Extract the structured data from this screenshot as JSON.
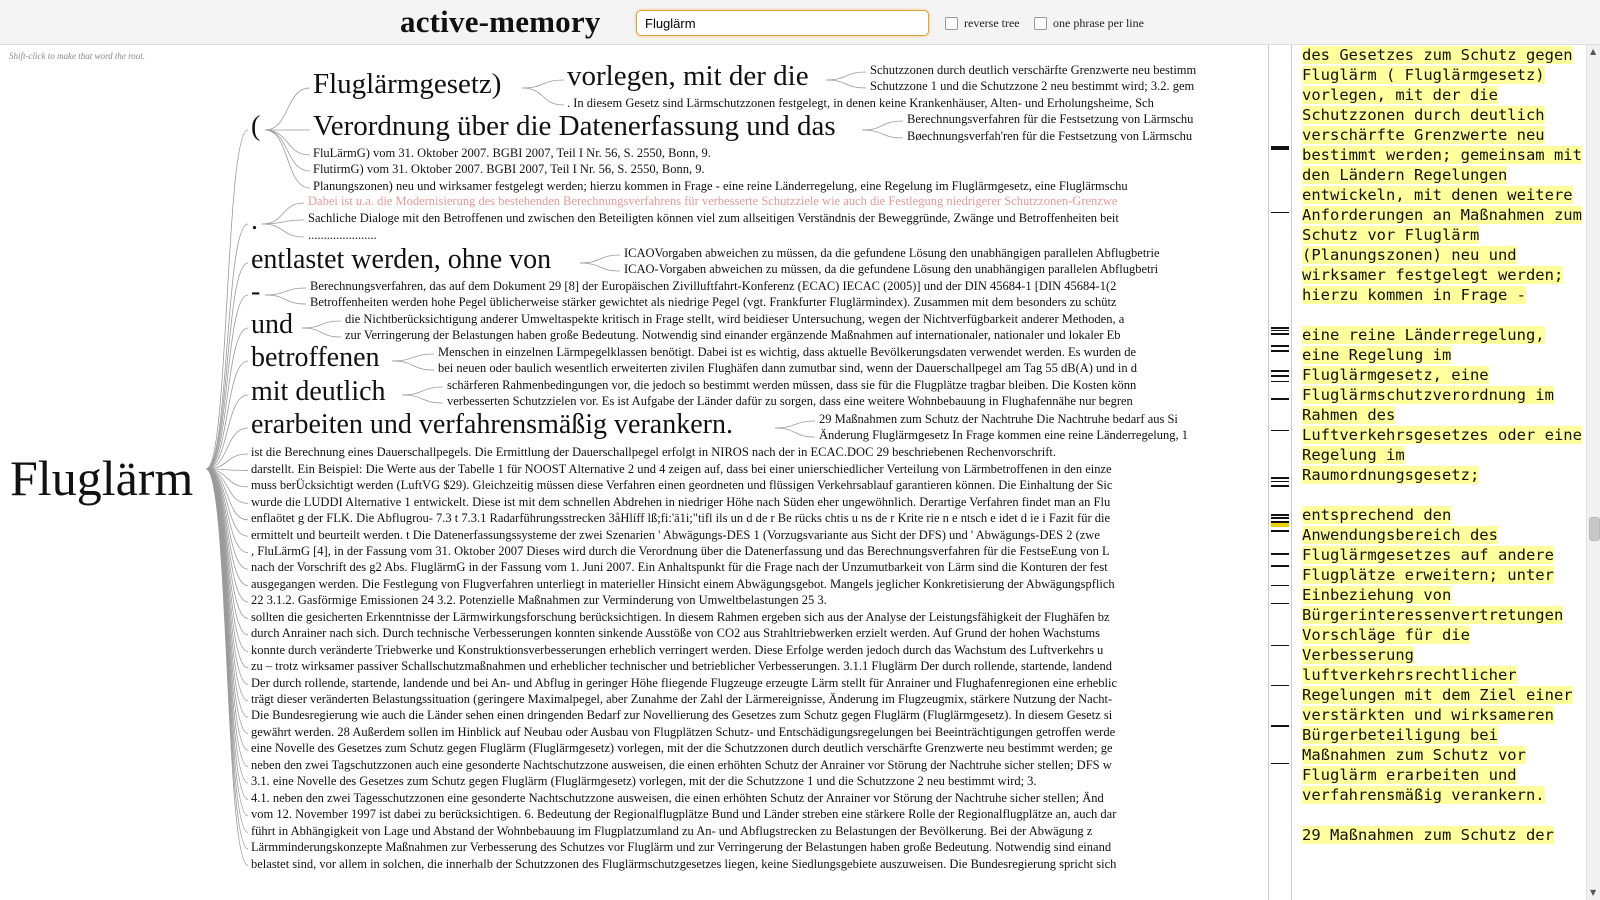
{
  "header": {
    "title": "active-memory",
    "search_value": "Fluglärm",
    "reverse_tree_label": "reverse tree",
    "one_phrase_label": "one phrase per line"
  },
  "tree": {
    "hint": "Shift-click to make that word the root.",
    "root": "Fluglärm",
    "l1": [
      "(",
      ".",
      "entlastet werden, ohne von",
      "-",
      "und",
      "betroffenen",
      "mit deutlich",
      "erarbeiten und verfahrensmäßig verankern."
    ],
    "paren_children": [
      "Fluglärmgesetz)",
      "Verordnung über die Datenerfassung und das",
      "FluLärmG) vom 31. Oktober 2007. BGBI 2007, Teil I Nr. 56, S. 2550, Bonn, 9.",
      "FlutirmG) vom 31. Oktober 2007. BGBI 2007, Teil I Nr. 56, S. 2550, Bonn, 9.",
      "Planungszonen) neu und wirksamer festgelegt werden; hierzu kommen in Frage - eine reine Länderregelung, eine Regelung im Fluglärmgesetz, eine Fluglärmschu"
    ],
    "fluglaermgesetz_children": [
      "vorlegen, mit der die",
      ". In diesem Gesetz sind Lärmschutzzonen festgelegt, in denen keine Krankenhäuser, Alten- und Erholungsheime, Sch"
    ],
    "vorlegen_children": [
      "Schutzzonen durch deutlich verschärfte Grenzwerte neu bestimm",
      "Schutzzone 1 und die Schutzzone 2 neu bestimmt wird; 3.2. gem"
    ],
    "verordnung_children": [
      "Berechnungsverfahren für die Festsetzung von Lärmschu",
      "Bøechnungsverfah'ren für die Festsetzung von Lärmschu"
    ],
    "dot_children": [
      "Dabei ist u.a. die Modernisierung des bestehenden Berechnungsverfahrens für verbesserte Schutzziele wie auch die Festlegung niedrigerer Schutzzonen-Grenzwe",
      "Sachliche Dialoge mit den Betroffenen und zwischen den Beteiligten können viel zum allseitigen Verständnis der Beweggründe, Zwänge und Betroffenheiten beit",
      "......................"
    ],
    "entlastet_children": [
      "ICAOVorgaben abweichen zu müssen, da die gefundene Lösung den unabhängigen parallelen Abflugbetrie",
      "ICAO-Vorgaben abweichen zu müssen, da die gefundene Lösung den unabhängigen parallelen Abflugbetri"
    ],
    "dash_children": [
      "Berechnungsverfahren, das auf dem Dokument 29 [8] der Europäischen Zivilluftfahrt-Konferenz (ECAC) IECAC (2005)] und der DIN 45684-1 [DIN 45684-1(2",
      "Betroffenheiten werden hohe Pegel üblicherweise stärker gewichtet als niedrige Pegel (vgt. Frankfurter Fluglärmindex). Zusammen mit dem besonders zu schütz"
    ],
    "und_children": [
      "die Nichtberücksichtigung anderer Umweltaspekte kritisch in Frage stellt, wird beidieser Untersuchung, wegen der Nichtverfügbarkeit anderer Methoden, a",
      "zur Verringerung der Belastungen haben große Bedeutung. Notwendig sind einander ergänzende Maßnahmen auf internationaler, nationaler und lokaler Eb"
    ],
    "betroffenen_children": [
      "Menschen in einzelnen Lärmpegelklassen benötigt. Dabei ist es wichtig, dass aktuelle Bevölkerungsdaten verwendet werden. Es wurden de",
      "bei neuen oder baulich wesentlich erweiterten zivilen Flughäfen dann zumutbar sind, wenn der Dauerschallpegel am Tag 55 dB(A) und in d"
    ],
    "deutlich_children": [
      "schärferen Rahmenbedingungen vor, die jedoch so bestimmt werden müssen, dass sie für die Flugplätze tragbar bleiben. Die Kosten könn",
      "verbesserten Schutzzielen vor. Es ist Aufgabe der Länder dafür zu sorgen, dass eine weitere Wohnbebauung in Flughafennähe nur begren"
    ],
    "erarbeiten_children": [
      "29 Maßnahmen zum Schutz der Nachtruhe Die Nachtruhe bedarf aus Si",
      "Änderung Fluglärmgesetz In Frage kommen eine reine Länderregelung, 1"
    ],
    "leaves": [
      "ist die Berechnung eines Dauerschallpegels. Die Ermittlung der Dauerschallpegel erfolgt in NIROS nach der in ECAC.DOC 29 beschriebenen Rechenvorschrift.",
      "darstellt. Ein Beispiel: Die Werte aus der Tabelle 1 für NOOST Alternative 2 und 4 zeigen auf, dass bei einer unierschiedlicher Verteilung von Lärmbetroffenen in den einze",
      "muss berÜcksichtigt werden (LuftVG $29). Gleichzeitig müssen diese Verfahren einen geordneten und flüssigen Verkehrsablauf garantieren können. Die Einhaltung der Sic",
      "wurde die LUDDI Alternative 1 entwickelt. Diese ist mit dem schnellen Abdrehen in niedriger Höhe nach Süden eher ungewöhnlich. Derartige Verfahren findet man an Flu",
      "enflaötet g der FLK. Die Abflugrou- 7.3 t 7.3.1 Radarführungsstrecken 3åHlíff lß;fi:'ä1i;\"tifl ils un d de r Be rücks chtis u ns de r Krite rie n e ntsch e idet d ie i Fazit für die",
      "ermittelt und beurteilt werden. t Die Datenerfassungssysteme der zwei Szenarien ' Abwägungs-DES 1 (Vorzugsvariante aus Sicht der DFS) und ' Abwägungs-DES 2 (zwe",
      ", FluLärmG [4], in der Fassung vom 31. Oktober 2007 Dieses wird durch die Verordnung über die Datenerfassung und das Berechnungsverfahren für die FestseEung von L",
      "nach der Vorschrift des g2 Abs. FluglärmG in der Fassung vom 1. Juni 2007. Ein Anhaltspunkt für die Frage nach der Unzumutbarkeit von Lärm sind die Konturen der fest",
      "ausgegangen werden. Die Festlegung von Flugverfahren unterliegt in materieller Hinsicht einem Abwägungsgebot. Mangels jeglicher Konkretisierung der Abwägungspflich",
      "22 3.1.2. Gasförmige Emissionen 24 3.2. Potenzielle Maßnahmen zur Verminderung von Umweltbelastungen 25 3.",
      "sollten die gesicherten Erkenntnisse der Lärmwirkungsforschung berücksichtigen. In diesem Rahmen ergeben sich aus der Analyse der Leistungsfähigkeit der Flughäfen bz",
      "durch Anrainer nach sich. Durch technische Verbesserungen konnten sinkende Ausstöße von CO2 aus Strahltriebwerken erzielt werden. Auf Grund der hohen Wachstums",
      "konnte durch veränderte Triebwerke und Konstruktionsverbesserungen erheblich verringert werden. Diese Erfolge werden jedoch durch das Wachstum des Luftverkehrs u",
      "zu – trotz wirksamer passiver Schallschutzmaßnahmen und erheblicher technischer und betrieblicher Verbesserungen. 3.1.1 Fluglärm Der durch rollende, startende, landend",
      "Der durch rollende, startende, landende und bei An- und Abflug in geringer Höhe fliegende Flugzeuge erzeugte Lärm stellt für Anrainer und Flughafenregionen eine erheblic",
      "trägt dieser veränderten Belastungssituation (geringere Maximalpegel, aber Zunahme der Zahl der Lärmereignisse, Änderung im Flugzeugmix, stärkere Nutzung der Nacht-",
      "Die Bundesregierung wie auch die Länder sehen einen dringenden Bedarf zur Novellierung des Gesetzes zum Schutz gegen Fluglärm (Fluglärmgesetz). In diesem Gesetz si",
      "gewährt werden. 28 Außerdem sollen im Hinblick auf Neubau oder Ausbau von Flugplätzen Schutz- und Entschädigungsregelungen bei Beeinträchtigungen getroffen werde",
      "eine Novelle des Gesetzes zum Schutz gegen Fluglärm (Fluglärmgesetz) vorlegen, mit der die Schutzzonen durch deutlich verschärfte Grenzwerte neu bestimmt werden; ge",
      "neben den zwei Tagschutzzonen auch eine gesonderte Nachtschutzzone ausweisen, die einen erhöhten Schutz der Anrainer vor Störung der Nachtruhe sicher stellen; DFS w",
      "3.1. eine Novelle des Gesetzes zum Schutz gegen Fluglärm (Fluglärmgesetz) vorlegen, mit der die Schutzzone 1 und die Schutzzone 2 neu bestimmt wird; 3.",
      "4.1. neben den zwei Tagesschutzzonen eine gesonderte Nachtschutzzone ausweisen, die einen erhöhten Schutz der Anrainer vor Störung der Nachtruhe sicher stellen; Änd",
      "vom 12. November 1997 ist dabei zu berücksichtigen. 6. Bedeutung der Regionalflugplätze Bund und Länder streben eine stärkere Rolle der Regionalflugplätze an, auch dar",
      "führt in Abhängigkeit von Lage und Abstand der Wohnbebauung im Flugplatzumland zu An- und Abflugstrecken zu Belastungen der Bevölkerung. Bei der Abwägung z",
      "Lärmminderungskonzepte Maßnahmen zur Verbesserung des Schutzes vor Fluglärm und zur Verringerung der Belastungen haben große Bedeutung. Notwendig sind einand",
      "belastet sind, vor allem in solchen, die innerhalb der Schutzzonen des Fluglärmschutzgesetzes liegen, keine Siedlungsgebiete auszuweisen. Die Bundesregierung spricht sich"
    ]
  },
  "textpanel": {
    "paragraphs": [
      [
        "des Gesetzes zum Schutz gegen Fluglärm ( Fluglärmgesetz) vorlegen, mit der die Schutzzonen durch deutlich verschärfte Grenzwerte neu bestimmt werden; gemeinsam mit den Ländern Regelungen entwickeln, mit denen weitere Anforderungen an Maßnahmen zum Schutz vor Fluglärm (Planungszonen) neu und wirksamer festgelegt werden; hierzu kommen in Frage -"
      ],
      [
        "eine reine Länderregelung, eine Regelung im Fluglärmgesetz, eine Fluglärmschutzverordnung im Rahmen des Luftverkehrsgesetzes oder eine Regelung im Raumordnungsgesetz;"
      ],
      [
        "entsprechend den Anwendungsbereich des Fluglärmgesetzes auf andere Flugplätze erweitern; unter Einbeziehung von Bürgerinteressenvertretungen Vorschläge für die Verbesserung luftverkehrsrechtlicher Regelungen mit dem Ziel einer verstärkten und wirksameren Bürgerbeteiligung bei Maßnahmen zum Schutz vor Fluglärm erarbeiten und verfahrensmäßig verankern."
      ],
      [
        "29 Maßnahmen zum Schutz der"
      ]
    ]
  },
  "colors": {
    "highlight": "#ffff9e",
    "search_border": "#e0a040",
    "pink_text": "#e39a9a"
  }
}
